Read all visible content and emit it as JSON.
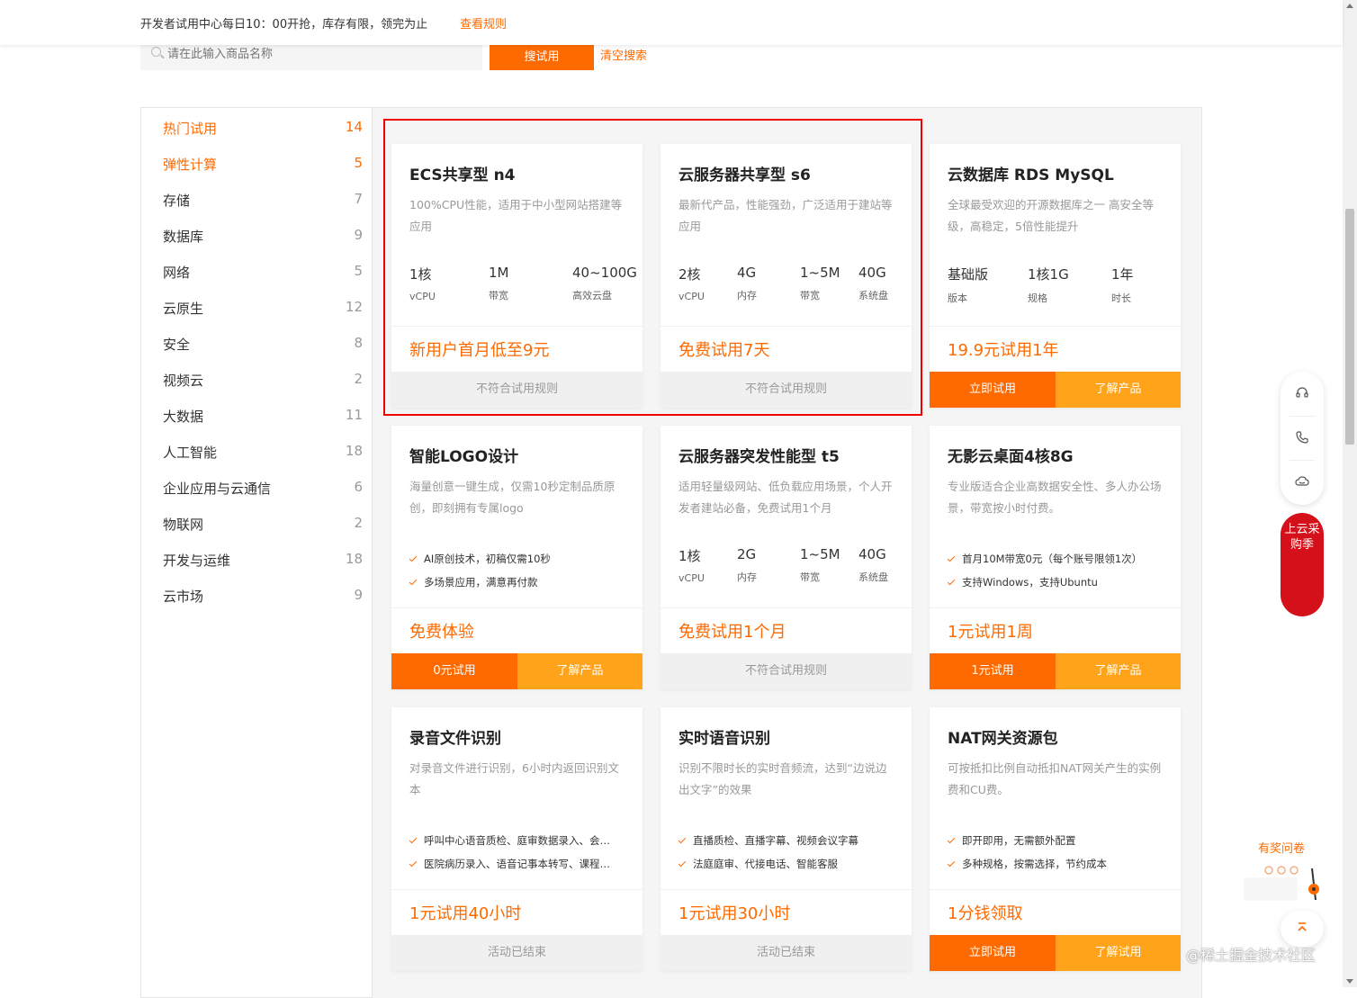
{
  "topbar": {
    "notice": "开发者试用中心每日10：00开抢，库存有限，领完为止",
    "rules_link": "查看规则"
  },
  "search": {
    "placeholder": "请在此输入商品名称",
    "search_button": "搜试用",
    "clear_button": "清空搜索"
  },
  "sidebar": {
    "items": [
      {
        "label": "热门试用",
        "count": "14"
      },
      {
        "label": "弹性计算",
        "count": "5"
      },
      {
        "label": "存储",
        "count": "7"
      },
      {
        "label": "数据库",
        "count": "9"
      },
      {
        "label": "网络",
        "count": "5"
      },
      {
        "label": "云原生",
        "count": "12"
      },
      {
        "label": "安全",
        "count": "8"
      },
      {
        "label": "视频云",
        "count": "2"
      },
      {
        "label": "大数据",
        "count": "11"
      },
      {
        "label": "人工智能",
        "count": "18"
      },
      {
        "label": "企业应用与云通信",
        "count": "6"
      },
      {
        "label": "物联网",
        "count": "2"
      },
      {
        "label": "开发与运维",
        "count": "18"
      },
      {
        "label": "云市场",
        "count": "9"
      }
    ]
  },
  "cards": [
    {
      "title": "ECS共享型 n4",
      "desc": "100%CPU性能，适用于中小型网站搭建等应用",
      "specs": [
        {
          "v": "1核",
          "k": "vCPU"
        },
        {
          "v": "1M",
          "k": "带宽"
        },
        {
          "v": "40~100G",
          "k": "高效云盘"
        }
      ],
      "price": "新用户首月低至9元",
      "footer": "不符合试用规则"
    },
    {
      "title": "云服务器共享型 s6",
      "desc": "最新代产品，性能强劲，广泛适用于建站等应用",
      "specs": [
        {
          "v": "2核",
          "k": "vCPU"
        },
        {
          "v": "4G",
          "k": "内存"
        },
        {
          "v": "1~5M",
          "k": "带宽"
        },
        {
          "v": "40G",
          "k": "系统盘"
        }
      ],
      "price": "免费试用7天",
      "footer": "不符合试用规则"
    },
    {
      "title": "云数据库 RDS MySQL",
      "desc": "全球最受欢迎的开源数据库之一 高安全等级，高稳定，5倍性能提升",
      "specs": [
        {
          "v": "基础版",
          "k": "版本"
        },
        {
          "v": "1核1G",
          "k": "规格"
        },
        {
          "v": "1年",
          "k": "时长"
        }
      ],
      "price": "19.9元试用1年",
      "btn_a": "立即试用",
      "btn_b": "了解产品"
    },
    {
      "title": "智能LOGO设计",
      "desc": "海量创意一键生成，仅需10秒定制品质原创，即刻拥有专属logo",
      "feats": [
        "AI原创技术，初稿仅需10秒",
        "多场景应用，满意再付款"
      ],
      "price": "免费体验",
      "btn_a": "0元试用",
      "btn_b": "了解产品"
    },
    {
      "title": "云服务器突发性能型 t5",
      "desc": "适用轻量级网站、低负载应用场景，个人开发者建站必备，免费试用1个月",
      "specs": [
        {
          "v": "1核",
          "k": "vCPU"
        },
        {
          "v": "2G",
          "k": "内存"
        },
        {
          "v": "1~5M",
          "k": "带宽"
        },
        {
          "v": "40G",
          "k": "系统盘"
        }
      ],
      "price": "免费试用1个月",
      "footer": "不符合试用规则"
    },
    {
      "title": "无影云桌面4核8G",
      "desc": "专业版适合企业高数据安全性、多人办公场景，带宽按小时付费。",
      "feats": [
        "首月10M带宽0元（每个账号限领1次）",
        "支持Windows，支持Ubuntu"
      ],
      "price": "1元试用1周",
      "btn_a": "1元试用",
      "btn_b": "了解产品"
    },
    {
      "title": "录音文件识别",
      "desc": "对录音文件进行识别，6小时内返回识别文本",
      "feats": [
        "呼叫中心语音质检、庭审数据录入、会…",
        "医院病历录入、语音记事本转写、课程…"
      ],
      "price": "1元试用40小时",
      "footer": "活动已结束"
    },
    {
      "title": "实时语音识别",
      "desc": "识别不限时长的实时音频流，达到“边说边出文字”的效果",
      "feats": [
        "直播质检、直播字幕、视频会议字幕",
        "法庭庭审、代接电话、智能客服"
      ],
      "price": "1元试用30小时",
      "footer": "活动已结束"
    },
    {
      "title": "NAT网关资源包",
      "desc": "可按抵扣比例自动抵扣NAT网关产生的实例费和CU费。",
      "feats": [
        "即开即用，无需额外配置",
        "多种规格，按需选择，节约成本"
      ],
      "price": "1分钱领取",
      "btn_a": "立即试用",
      "btn_b": "了解试用"
    }
  ],
  "float": {
    "icons": [
      "headset-icon",
      "phone-icon",
      "chat-cloud-icon"
    ],
    "promo": "上云采购季",
    "survey": "有奖问卷"
  },
  "watermark": "@稀土掘金技术社区",
  "colors": {
    "accent": "#ff6a00",
    "accent_light": "#ffa31a",
    "highlight": "#e00000"
  }
}
